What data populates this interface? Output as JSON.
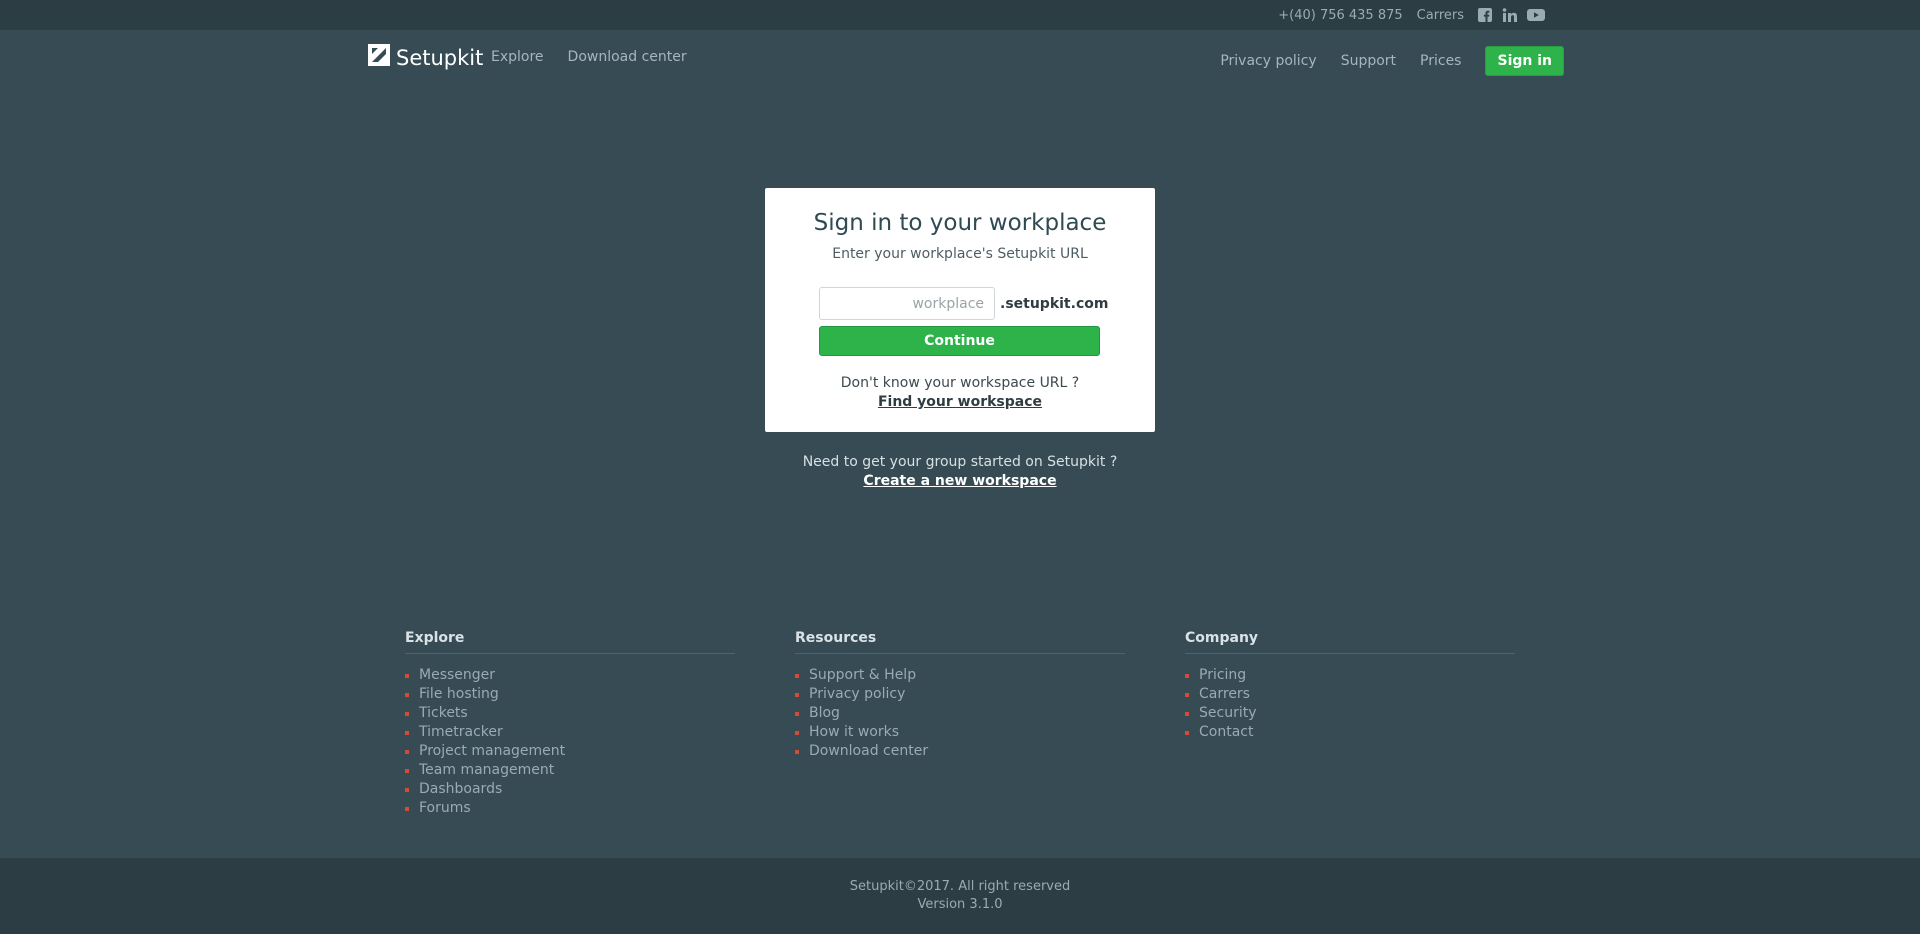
{
  "topbar": {
    "phone": "+(40) 756 435 875",
    "carrers": "Carrers",
    "icons": [
      "facebook-icon",
      "linkedin-icon",
      "youtube-icon"
    ]
  },
  "header": {
    "brand": "Setupkit",
    "nav_left": [
      "Explore",
      "Download center"
    ],
    "nav_right": [
      "Privacy policy",
      "Support",
      "Prices"
    ],
    "signin": "Sign in"
  },
  "card": {
    "title": "Sign in to your workplace",
    "subtitle": "Enter your workplace's Setupkit URL",
    "input_placeholder": "workplace",
    "input_value": "",
    "suffix": ".setupkit.com",
    "continue": "Continue",
    "help_text": "Don't know your workspace URL ?",
    "help_link": "Find your workspace"
  },
  "below": {
    "text": "Need to get your group started on Setupkit ?",
    "link": "Create a new workspace"
  },
  "footer": {
    "explore": {
      "title": "Explore",
      "items": [
        "Messenger",
        "File hosting",
        "Tickets",
        "Timetracker",
        "Project management",
        "Team management",
        "Dashboards",
        "Forums"
      ]
    },
    "resources": {
      "title": "Resources",
      "items": [
        "Support & Help",
        "Privacy policy",
        "Blog",
        "How it works",
        "Download center"
      ]
    },
    "company": {
      "title": "Company",
      "items": [
        "Pricing",
        "Carrers",
        "Security",
        "Contact"
      ]
    }
  },
  "bottom": {
    "copyright": "Setupkit©2017. All right reserved",
    "version": "Version 3.1.0"
  },
  "colors": {
    "background": "#364b54",
    "topbar": "#2c3d44",
    "accent_green": "#2db34a",
    "bullet_red": "#d64a3a"
  }
}
